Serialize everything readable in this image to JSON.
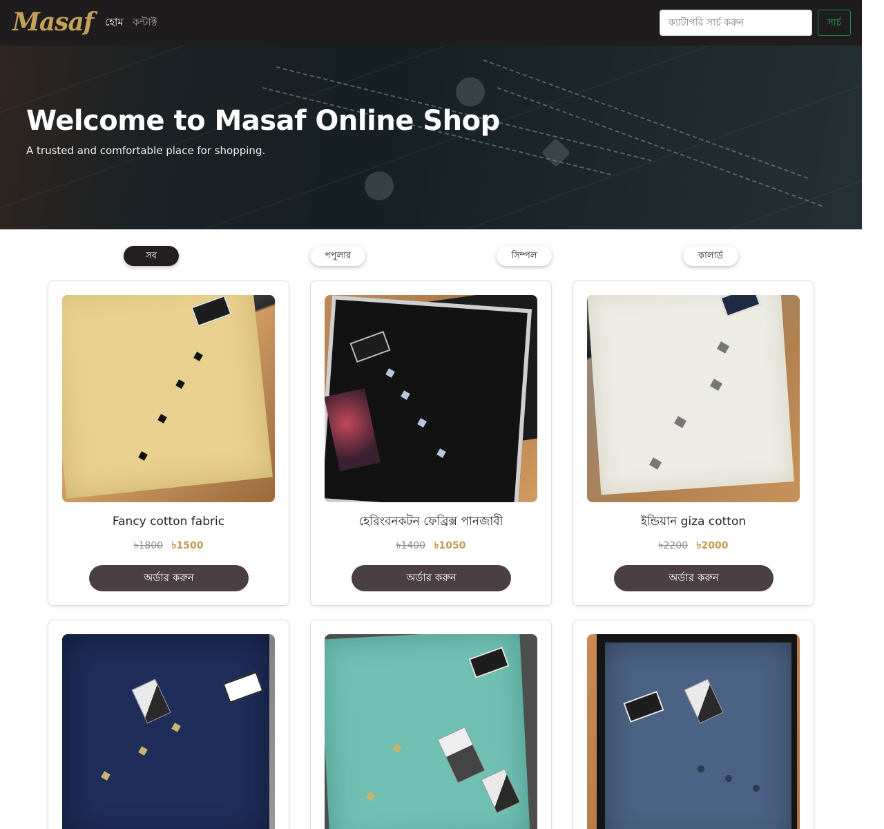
{
  "brand": {
    "logo_text": "Masaf",
    "accent_color": "#c5a15a"
  },
  "nav": {
    "home_label": "হোম",
    "contact_label": "কন্টাক্ট",
    "search_placeholder": "ক্যাটাগরি সার্চ করুন",
    "search_button_label": "সার্চ",
    "search_button_color": "#28a745"
  },
  "hero": {
    "title": "Welcome to Masaf Online Shop",
    "subtitle": "A trusted and comfortable place for shopping."
  },
  "filters": [
    {
      "label": "সব",
      "active": true
    },
    {
      "label": "পপুলার",
      "active": false
    },
    {
      "label": "সিম্পল",
      "active": false
    },
    {
      "label": "কালার্ড",
      "active": false
    }
  ],
  "products": [
    {
      "name": "Fancy cotton fabric",
      "old_price": "৳1800",
      "new_price": "৳1500",
      "order_label": "অর্ডার করুন",
      "shirt_color": "#e8d08e"
    },
    {
      "name": "হেরিংবনকটন ফেব্রিক্স পানজাবী",
      "old_price": "৳1400",
      "new_price": "৳1050",
      "order_label": "অর্ডার করুন",
      "shirt_color": "#121213"
    },
    {
      "name": "ইন্ডিয়ান giza cotton",
      "old_price": "৳2200",
      "new_price": "৳2000",
      "order_label": "অর্ডার করুন",
      "shirt_color": "#ecebe4"
    },
    {
      "name": "",
      "old_price": "",
      "new_price": "",
      "order_label": "",
      "shirt_color": "#1e2d5a"
    },
    {
      "name": "",
      "old_price": "",
      "new_price": "",
      "order_label": "",
      "shirt_color": "#6fbfb3"
    },
    {
      "name": "",
      "old_price": "",
      "new_price": "",
      "order_label": "",
      "shirt_color": "#4a6283"
    }
  ],
  "price_colors": {
    "old": "#8a8a8a",
    "new": "#c29b52"
  },
  "order_button_color": "#4a3f42"
}
